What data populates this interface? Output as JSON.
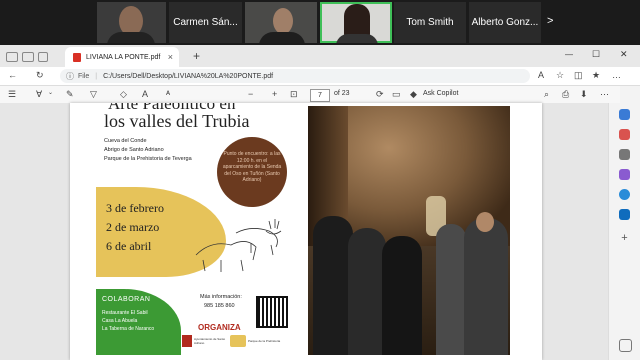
{
  "meeting": {
    "participants": [
      {
        "name": ""
      },
      {
        "name": "Carmen Sán..."
      },
      {
        "name": ""
      },
      {
        "name": ""
      },
      {
        "name": "Tom Smith"
      },
      {
        "name": "Alberto Gonz..."
      }
    ],
    "next_label": ">"
  },
  "browser": {
    "tab_title": "LIVIANA LA PONTE.pdf",
    "tab_close": "×",
    "new_tab": "+",
    "address_prefix": "File",
    "address_url": "C:/Users/Dell/Desktop/LIVIANA%20LA%20PONTE.pdf",
    "window_min": "—",
    "window_max": "☐",
    "window_close": "✕"
  },
  "pdf_toolbar": {
    "page_current": "7",
    "page_total": "of 23",
    "copilot_label": "Ask Copilot",
    "zoom_minus": "−",
    "zoom_plus": "+"
  },
  "poster": {
    "title_line1": "Arte Paleolítico en",
    "title_line2": "los valles del Trubia",
    "places": [
      "Cueva del Conde",
      "Abrigo de Santo Adriano",
      "Parque de la Prehistoria de Teverga"
    ],
    "meeting_text": "Punto de encuentro: a las 12:00 h. en el aparcamiento de la Senda del Oso en Tuñón (Santo Adriano)",
    "dates": [
      "3 de febrero",
      "2 de marzo",
      "6 de abril"
    ],
    "collab_title": "COLABORAN",
    "collaborators": [
      "Restaurante El Sabil",
      "Casa La Abuela",
      "La Taberna de Naranco"
    ],
    "info_label": "Más información:",
    "info_phone": "985 185 860",
    "organiza": "ORGANIZA",
    "logo_texts": [
      "Ayuntamiento de Santo Adriano",
      "Parque de la Prehistoria"
    ]
  },
  "colors": {
    "green": "#3c9a34",
    "yellow": "#e6c35a",
    "brown": "#6b3a1f",
    "red_title": "#b12a1e",
    "active_border": "#3fbf58"
  }
}
